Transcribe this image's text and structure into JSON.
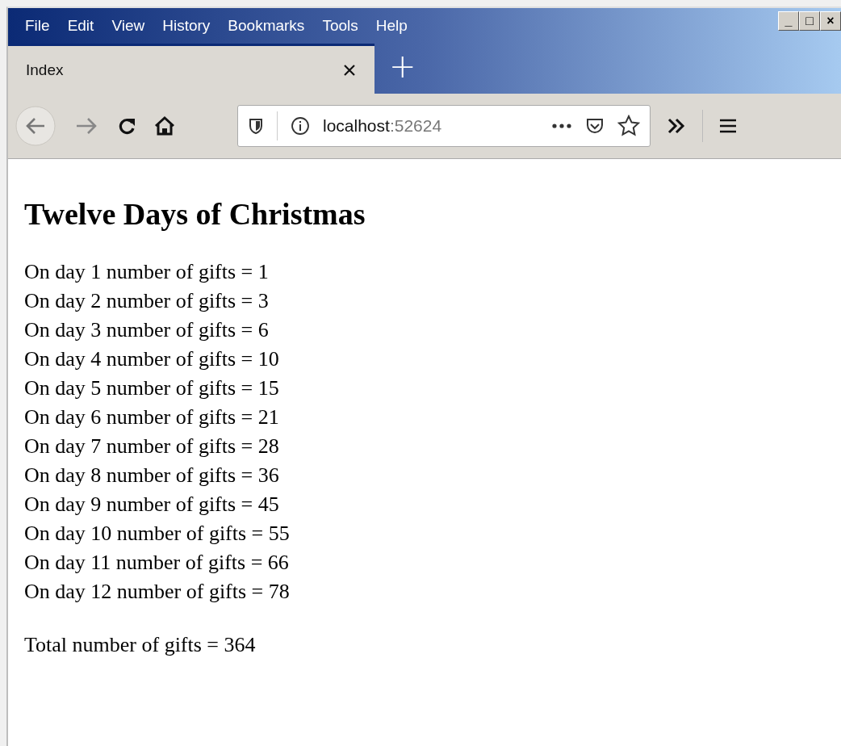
{
  "menu": [
    "File",
    "Edit",
    "View",
    "History",
    "Bookmarks",
    "Tools",
    "Help"
  ],
  "window_controls": [
    "_",
    "□",
    "×"
  ],
  "tabs": [
    {
      "label": "Index",
      "selected": true
    }
  ],
  "new_tab": "+",
  "address": {
    "host": "localhost",
    "port": ":52624"
  },
  "page": {
    "heading": "Twelve Days of Christmas",
    "lines": [
      "On day 1 number of gifts = 1",
      "On day 2 number of gifts = 3",
      "On day 3 number of gifts = 6",
      "On day 4 number of gifts = 10",
      "On day 5 number of gifts = 15",
      "On day 6 number of gifts = 21",
      "On day 7 number of gifts = 28",
      "On day 8 number of gifts = 36",
      "On day 9 number of gifts = 45",
      "On day 10 number of gifts = 55",
      "On day 11 number of gifts = 66",
      "On day 12 number of gifts = 78"
    ],
    "total": "Total number of gifts = 364"
  }
}
